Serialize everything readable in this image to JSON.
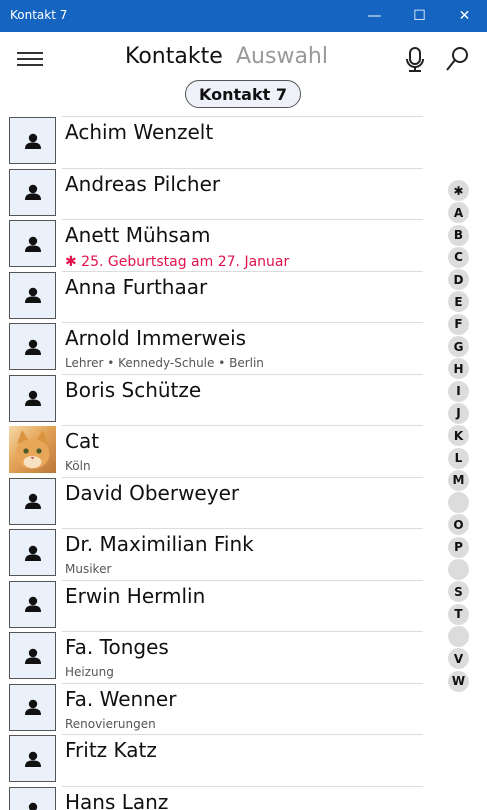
{
  "window": {
    "title": "Kontakt 7",
    "minimize": "—",
    "maximize": "☐",
    "close": "✕"
  },
  "header": {
    "tabs": [
      {
        "label": "Kontakte",
        "active": true
      },
      {
        "label": "Auswahl",
        "active": false
      }
    ],
    "badge": "Kontakt 7",
    "icons": [
      "hamburger-menu-icon",
      "microphone-icon",
      "search-icon"
    ]
  },
  "contacts": [
    {
      "name": "Achim Wenzelt",
      "sub": "",
      "photo": false
    },
    {
      "name": "Andreas Pilcher",
      "sub": "",
      "photo": false
    },
    {
      "name": "Anett Mühsam",
      "sub": "✱ 25. Geburtstag am 27. Januar",
      "birthday": true,
      "photo": false
    },
    {
      "name": "Anna Furthaar",
      "sub": "",
      "photo": false
    },
    {
      "name": "Arnold Immerweis",
      "sub": "Lehrer • Kennedy-Schule • Berlin",
      "photo": false
    },
    {
      "name": "Boris Schütze",
      "sub": "",
      "photo": false
    },
    {
      "name": "Cat",
      "sub": "Köln",
      "photo": true
    },
    {
      "name": "David Oberweyer",
      "sub": "",
      "photo": false
    },
    {
      "name": "Dr. Maximilian Fink",
      "sub": "Musiker",
      "photo": false
    },
    {
      "name": "Erwin Hermlin",
      "sub": "",
      "photo": false
    },
    {
      "name": "Fa. Tonges",
      "sub": "Heizung",
      "photo": false
    },
    {
      "name": "Fa. Wenner",
      "sub": "Renovierungen",
      "photo": false
    },
    {
      "name": "Fritz Katz",
      "sub": "",
      "photo": false
    },
    {
      "name": "Hans Lanz",
      "sub": "",
      "photo": false
    }
  ],
  "alphabet_index": [
    "✱",
    "A",
    "B",
    "C",
    "D",
    "E",
    "F",
    "G",
    "H",
    "I",
    "J",
    "K",
    "L",
    "M",
    "",
    "O",
    "P",
    "",
    "S",
    "T",
    "",
    "V",
    "W"
  ],
  "colors": {
    "titlebar": "#1565c0",
    "birthday": "#e0114d"
  }
}
